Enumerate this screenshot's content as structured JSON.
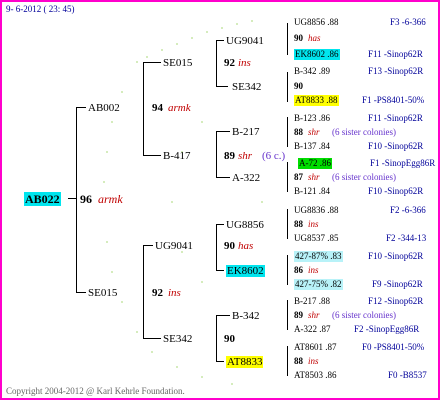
{
  "date": "9- 6-2012 ( 23: 45)",
  "copyright": "Copyright 2004-2012 @ Karl Kehrle Foundation.",
  "gen0": {
    "id": "AB022",
    "year": "96",
    "tag": "armk"
  },
  "gen1": [
    {
      "id": "AB002",
      "year": "94",
      "tag": "armk"
    },
    {
      "id": "SE015",
      "year": "92",
      "tag": "ins"
    }
  ],
  "gen2": [
    {
      "id": "SE015",
      "year": "92",
      "tag": "ins"
    },
    {
      "id": "B-417",
      "year": "89",
      "tag": "shr",
      "note": "(6 c.)"
    },
    {
      "id": "UG9041",
      "year": "90",
      "tag": "has"
    },
    {
      "id": "SE342",
      "year": "90",
      "tag": ""
    }
  ],
  "gen3": [
    {
      "id": "UG9041",
      "year": "92",
      "tag": "ins"
    },
    {
      "id": "SE342",
      "year": "",
      "tag": ""
    },
    {
      "id": "B-217",
      "year": "89",
      "tag": "shr",
      "note": "(6 c.)"
    },
    {
      "id": "A-322",
      "year": "87",
      "tag": ""
    },
    {
      "id": "UG8856",
      "year": "90",
      "tag": "has"
    },
    {
      "id": "EK8602",
      "year": "",
      "tag": ""
    },
    {
      "id": "B-342",
      "year": "",
      "tag": ""
    },
    {
      "id": "AT8833",
      "year": "",
      "tag": ""
    }
  ],
  "gen4": [
    {
      "a": "UG8856 .88",
      "b": "90",
      "btag": "has",
      "c": "EK8602 .86",
      "ra": "F3 -6-366",
      "rc": "F11 -Sinop62R"
    },
    {
      "a": "B-342 .89",
      "b": "90",
      "btag": "",
      "c": "AT8833 .88",
      "ra": "F13 -Sinop62R",
      "rc": "F1 -PS8401-50%"
    },
    {
      "a": "B-123 .86",
      "b": "88",
      "btag": "shr",
      "bnote": "(6 sister colonies)",
      "c": "B-137 .84",
      "ra": "F11 -Sinop62R",
      "rc": "F10 -Sinop62R"
    },
    {
      "a": "A-72 .86",
      "b": "87",
      "btag": "shr",
      "bnote": "(6 sister colonies)",
      "c": "B-121 .84",
      "ra": "F1 -SinopEgg86R",
      "rc": "F10 -Sinop62R"
    },
    {
      "a": "UG8836 .88",
      "b": "88",
      "btag": "ins",
      "c": "UG8537 .85",
      "ra": "F2 -6-366",
      "rc": "F2 -344-13"
    },
    {
      "a": "427-87% .83",
      "b": "86",
      "btag": "ins",
      "c": "427-75% .82",
      "ra": "F10 -Sinop62R",
      "rc": "F9 -Sinop62R"
    },
    {
      "a": "B-217 .88",
      "b": "89",
      "btag": "shr",
      "bnote": "(6 sister colonies)",
      "c": "A-322 .87",
      "ra": "F12 -Sinop62R",
      "rc": "F2 -SinopEgg86R"
    },
    {
      "a": "AT8601 .87",
      "b": "88",
      "btag": "ins",
      "c": "AT8503 .86",
      "ra": "F0 -PS8401-50%",
      "rc": "F0 -B8537"
    }
  ]
}
